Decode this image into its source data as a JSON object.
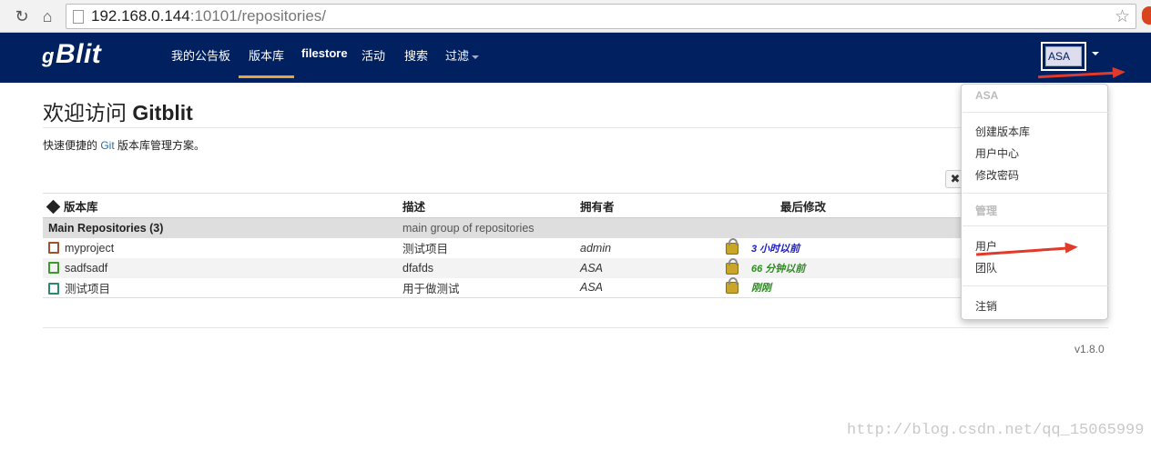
{
  "browser": {
    "url_host": "192.168.0.144",
    "url_rest": ":10101/repositories/"
  },
  "nav": {
    "brand": "Blit",
    "brand_mark": "g",
    "items": [
      "我的公告板",
      "版本库",
      "filestore",
      "活动",
      "搜索",
      "过滤"
    ],
    "active": "版本库",
    "user": "ASA"
  },
  "page": {
    "title_prefix": "欢迎访问 ",
    "title_name": "Gitblit",
    "subtitle_before": "快速便捷的 ",
    "subtitle_link": "Git",
    "subtitle_after": " 版本库管理方案。",
    "close_label": "✖"
  },
  "table": {
    "headers": [
      "版本库",
      "描述",
      "拥有者",
      "最后修改"
    ],
    "group": {
      "name": "Main Repositories (3)",
      "description": "main group of repositories"
    },
    "rows": [
      {
        "name": "myproject",
        "description": "测试项目",
        "owner": "admin",
        "ago": "3 小时以前",
        "ago_color": "#1a1acc",
        "icon_color": "#a0522d"
      },
      {
        "name": "sadfsadf",
        "description": "dfafds",
        "owner": "ASA",
        "ago": "66 分钟以前",
        "ago_color": "#2e8b22",
        "icon_color": "#3a9a2a"
      },
      {
        "name": "测试项目",
        "description": "用于做测试",
        "owner": "ASA",
        "ago": "刚刚",
        "ago_color": "#2e8b22",
        "icon_color": "#2a8a6a"
      }
    ]
  },
  "dropdown": {
    "user_header": "ASA",
    "items_user": [
      "创建版本库",
      "用户中心",
      "修改密码"
    ],
    "admin_header": "管理",
    "items_admin": [
      "用户",
      "团队"
    ],
    "logout": "注销"
  },
  "footer": {
    "version": "v1.8.0"
  },
  "watermark": "http://blog.csdn.net/qq_15065999",
  "colors": {
    "navbar": "#002060",
    "active_underline": "#e8a33b",
    "arrow": "#e23a2a"
  }
}
